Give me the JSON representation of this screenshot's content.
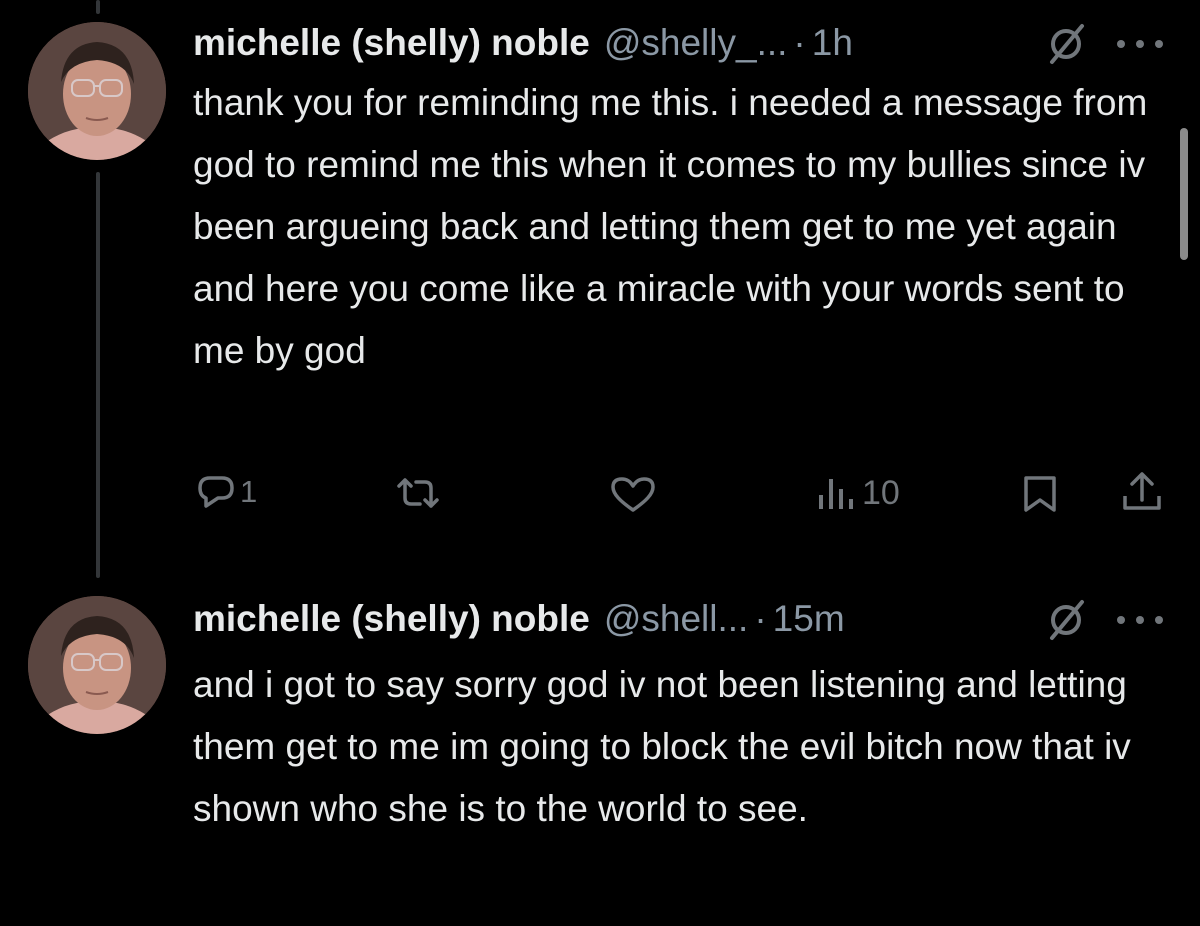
{
  "tweets": [
    {
      "name": "michelle (shelly) noble",
      "handle": "@shelly_...",
      "time": "1h",
      "text": "thank you for reminding me this. i needed a message from god to remind me this when it comes to my bullies since iv been argueing back and letting them get to me yet again and here you come like a miracle with your words sent to me by god",
      "replies": "1",
      "views": "10"
    },
    {
      "name": "michelle (shelly) noble",
      "handle": "@shell...",
      "time": "15m",
      "text": "and i got to say sorry god iv not been listening and letting them get to me im going to block the evil bitch now that iv shown who she is to the world to see."
    }
  ],
  "separator": "·",
  "icons": [
    "avatar",
    "grok-icon",
    "more-icon",
    "reply-icon",
    "repost-icon",
    "like-icon",
    "views-icon",
    "bookmark-icon",
    "share-icon"
  ]
}
